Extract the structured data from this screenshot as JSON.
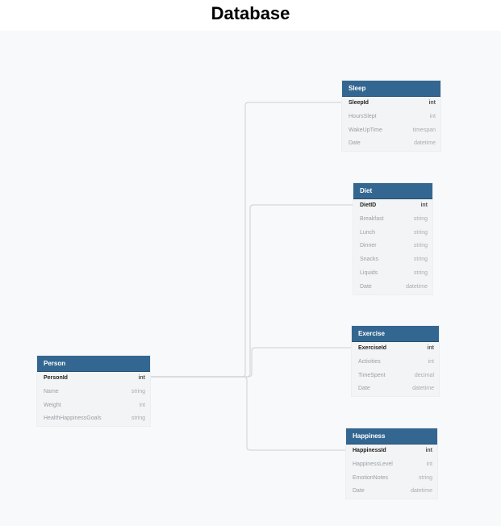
{
  "title": "Database",
  "tables": {
    "sleep": {
      "name": "Sleep",
      "columns": [
        {
          "name": "SleepId",
          "type": "int"
        },
        {
          "name": "HoursSlept",
          "type": "int"
        },
        {
          "name": "WakeUpTime",
          "type": "timespan"
        },
        {
          "name": "Date",
          "type": "datetime"
        }
      ]
    },
    "diet": {
      "name": "Diet",
      "columns": [
        {
          "name": "DietID",
          "type": "int"
        },
        {
          "name": "Breakfast",
          "type": "string"
        },
        {
          "name": "Lunch",
          "type": "string"
        },
        {
          "name": "Dinner",
          "type": "string"
        },
        {
          "name": "Snacks",
          "type": "string"
        },
        {
          "name": "Liquids",
          "type": "string"
        },
        {
          "name": "Date",
          "type": "datetime"
        }
      ]
    },
    "exercise": {
      "name": "Exercise",
      "columns": [
        {
          "name": "ExerciseId",
          "type": "int"
        },
        {
          "name": "Activities",
          "type": "int"
        },
        {
          "name": "TimeSpent",
          "type": "decimal"
        },
        {
          "name": "Date",
          "type": "datetime"
        }
      ]
    },
    "person": {
      "name": "Person",
      "columns": [
        {
          "name": "PersonId",
          "type": "int"
        },
        {
          "name": "Name",
          "type": "string"
        },
        {
          "name": "Weight",
          "type": "int"
        },
        {
          "name": "HealthHappinessGoals",
          "type": "string"
        }
      ]
    },
    "happiness": {
      "name": "Happiness",
      "columns": [
        {
          "name": "HappinessId",
          "type": "int"
        },
        {
          "name": "HappinessLevel",
          "type": "int"
        },
        {
          "name": "EmotionNotes",
          "type": "string"
        },
        {
          "name": "Date",
          "type": "datetime"
        }
      ]
    }
  },
  "colors": {
    "header": "#336791",
    "connector": "#d4d8dc",
    "canvas": "#f8f9fa"
  }
}
